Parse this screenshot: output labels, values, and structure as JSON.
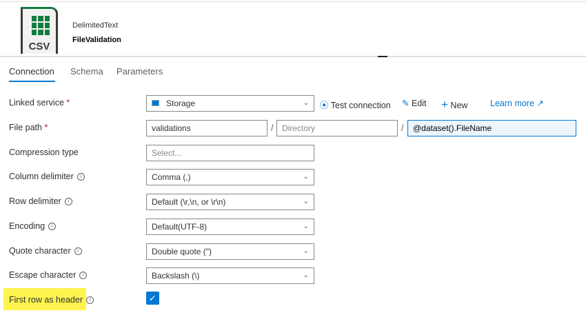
{
  "header": {
    "type": "DelimitedText",
    "name": "FileValidation",
    "icon_label": "CSV"
  },
  "tabs": [
    "Connection",
    "Schema",
    "Parameters"
  ],
  "fields": {
    "linked_service": {
      "label": "Linked service",
      "value": "Storage"
    },
    "file_path": {
      "label": "File path",
      "container": "validations",
      "directory_placeholder": "Directory",
      "file": "@dataset().FileName",
      "separator": "/"
    },
    "compression": {
      "label": "Compression type",
      "placeholder": "Select..."
    },
    "column_delimiter": {
      "label": "Column delimiter",
      "value": "Comma (,)"
    },
    "row_delimiter": {
      "label": "Row delimiter",
      "value": "Default (\\r,\\n, or \\r\\n)"
    },
    "encoding": {
      "label": "Encoding",
      "value": "Default(UTF-8)"
    },
    "quote": {
      "label": "Quote character",
      "value": "Double quote (\")"
    },
    "escape": {
      "label": "Escape character",
      "value": "Backslash (\\)"
    },
    "first_row": {
      "label": "First row as header",
      "checked": true
    }
  },
  "actions": {
    "test": "Test connection",
    "edit": "Edit",
    "new": "New",
    "learn": "Learn more"
  },
  "required_mark": "*"
}
